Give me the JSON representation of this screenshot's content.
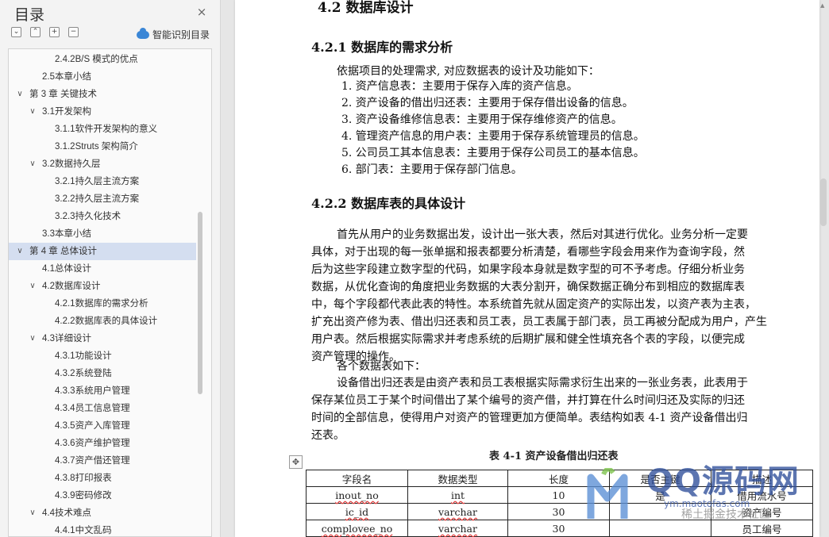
{
  "sidebar": {
    "title": "目录",
    "close_icon": "×",
    "tools": {
      "collapse": "⌄",
      "expand": "⌃",
      "add": "+",
      "remove": "−"
    },
    "smart_toc_label": "智能识别目录",
    "items": [
      {
        "label": "2.4.2B/S 模式的优点",
        "level": 3,
        "chevron": ""
      },
      {
        "label": "2.5本章小结",
        "level": 2,
        "chevron": ""
      },
      {
        "label": "第 3 章  关键技术",
        "level": 1,
        "chevron": "∨"
      },
      {
        "label": "3.1开发架构",
        "level": 2,
        "chevron": "∨"
      },
      {
        "label": "3.1.1软件开发架构的意义",
        "level": 3,
        "chevron": ""
      },
      {
        "label": "3.1.2Struts 架构简介",
        "level": 3,
        "chevron": ""
      },
      {
        "label": "3.2数据持久层",
        "level": 2,
        "chevron": "∨"
      },
      {
        "label": "3.2.1持久层主流方案",
        "level": 3,
        "chevron": ""
      },
      {
        "label": "3.2.2持久层主流方案",
        "level": 3,
        "chevron": ""
      },
      {
        "label": "3.2.3持久化技术",
        "level": 3,
        "chevron": ""
      },
      {
        "label": "3.3本章小结",
        "level": 2,
        "chevron": ""
      },
      {
        "label": "第 4 章  总体设计",
        "level": 1,
        "chevron": "∨",
        "selected": true
      },
      {
        "label": "4.1总体设计",
        "level": 2,
        "chevron": ""
      },
      {
        "label": "4.2数据库设计",
        "level": 2,
        "chevron": "∨"
      },
      {
        "label": "4.2.1数据库的需求分析",
        "level": 3,
        "chevron": ""
      },
      {
        "label": "4.2.2数据库表的具体设计",
        "level": 3,
        "chevron": ""
      },
      {
        "label": "4.3详细设计",
        "level": 2,
        "chevron": "∨"
      },
      {
        "label": "4.3.1功能设计",
        "level": 3,
        "chevron": ""
      },
      {
        "label": "4.3.2系统登陆",
        "level": 3,
        "chevron": ""
      },
      {
        "label": "4.3.3系统用户管理",
        "level": 3,
        "chevron": ""
      },
      {
        "label": "4.3.4员工信息管理",
        "level": 3,
        "chevron": ""
      },
      {
        "label": "4.3.5资产入库管理",
        "level": 3,
        "chevron": ""
      },
      {
        "label": "4.3.6资产维护管理",
        "level": 3,
        "chevron": ""
      },
      {
        "label": "4.3.7资产借还管理",
        "level": 3,
        "chevron": ""
      },
      {
        "label": "4.3.8打印报表",
        "level": 3,
        "chevron": ""
      },
      {
        "label": "4.3.9密码修改",
        "level": 3,
        "chevron": ""
      },
      {
        "label": "4.4技术难点",
        "level": 2,
        "chevron": "∨"
      },
      {
        "label": "4.4.1中文乱码",
        "level": 3,
        "chevron": ""
      }
    ]
  },
  "doc": {
    "section_42": "4.2  数据库设计",
    "section_421": "4.2.1  数据库的需求分析",
    "intro": "依据项目的处理需求, 对应数据表的设计及功能如下：",
    "list": [
      "1.  资产信息表：主要用于保存入库的资产信息。",
      "2.  资产设备的借出归还表：主要用于保存借出设备的信息。",
      "3.  资产设备维修信息表：主要用于保存维修资产的信息。",
      "4.  管理资产信息的用户表：主要用于保存系统管理员的信息。",
      "5.  公司员工其本信息表：主要用于保存公司员工的基本信息。",
      "6.  部门表：主要用于保存部门信息。"
    ],
    "section_422": "4.2.2  数据库表的具体设计",
    "para1": [
      "首先从用户的业务数据出发，设计出一张大表，然后对其进行优化。业务分析一定要",
      "具体，对于出现的每一张单据和报表都要分析清楚，看哪些字段会用来作为查询字段，然",
      "后为这些字段建立数字型的代码，如果字段本身就是数字型的可不予考虑。仔细分析业务",
      "数据，从优化查询的角度把业务数据的大表分割开，确保数据正确分布到相应的数据库表",
      "中，每个字段都代表此表的特性。本系统首先就从固定资产的实际出发，以资产表为主表，",
      "扩充出资产修为表、借出归还表和员工表，员工表属于部门表，员工再被分配成为用户，产生",
      "用户表。然后根据实际需求并考虑系统的后期扩展和健全性填充各个表的字段，以便完成",
      "资产管理的操作。"
    ],
    "para2": "各个数据表如下：",
    "para3": [
      "设备借出归还表是由资产表和员工表根据实际需求衍生出来的一张业务表，此表用于",
      "保存某位员工于某个时间借出了某个编号的资产借，并打算在什么时间归还及实际的归还",
      "时间的全部信息，使得用户对资产的管理更加方便简单。表结构如表 4-1 资产设备借出归",
      "还表。"
    ],
    "table_title": "表 4-1    资产设备借出归还表",
    "move_icon": "✥",
    "table": {
      "headers": [
        "字段名",
        "数据类型",
        "长度",
        "是否主键",
        "描述"
      ],
      "rows": [
        [
          "inout_no",
          "int",
          "10",
          "是",
          "借用流水号"
        ],
        [
          "ic_id",
          "varchar",
          "30",
          "",
          "资产编号"
        ],
        [
          "complovee_no",
          "varchar",
          "30",
          "",
          "员工编号"
        ]
      ]
    }
  },
  "watermark": {
    "text": "QQ源码网",
    "url": "ym.maotofas.com",
    "badge": "稀土掘金技术社区"
  }
}
